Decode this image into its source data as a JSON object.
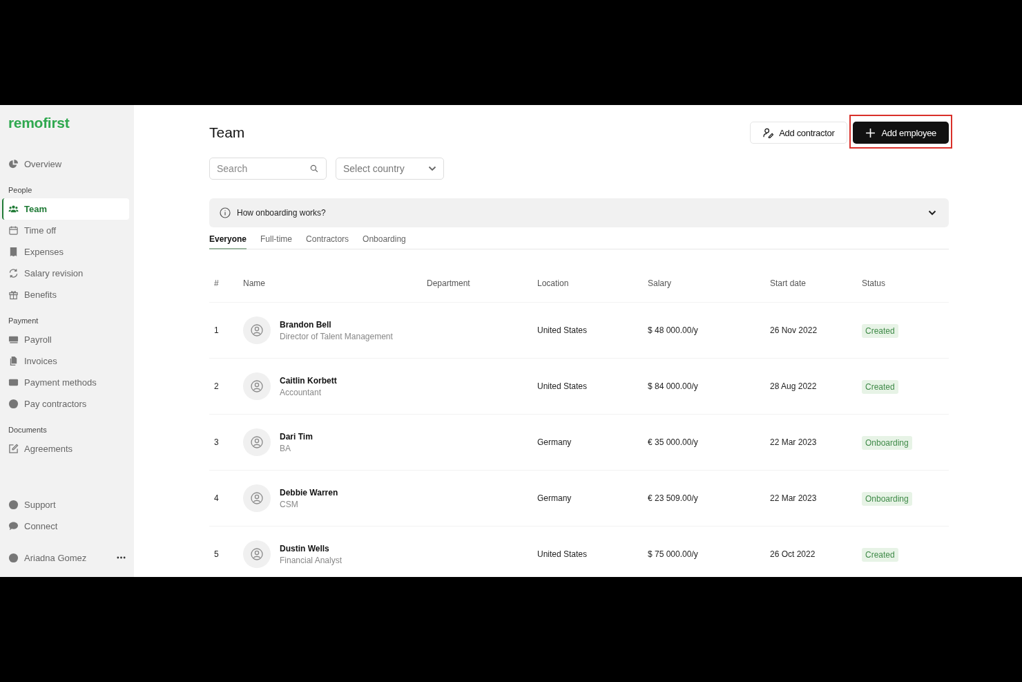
{
  "logo": "remofirst",
  "sidebar": {
    "sections": [
      {
        "items": [
          {
            "label": "Overview",
            "selected": false
          }
        ]
      },
      {
        "title": "People",
        "items": [
          {
            "label": "Team",
            "selected": true
          },
          {
            "label": "Time off",
            "selected": false
          },
          {
            "label": "Expenses",
            "selected": false
          },
          {
            "label": "Salary revision",
            "selected": false
          },
          {
            "label": "Benefits",
            "selected": false
          }
        ]
      },
      {
        "title": "Payment",
        "items": [
          {
            "label": "Payroll",
            "selected": false
          },
          {
            "label": "Invoices",
            "selected": false
          },
          {
            "label": "Payment methods",
            "selected": false
          },
          {
            "label": "Pay contractors",
            "selected": false
          }
        ]
      },
      {
        "title": "Documents",
        "items": [
          {
            "label": "Agreements",
            "selected": false
          }
        ]
      }
    ],
    "footer": [
      {
        "label": "Support",
        "selected": false
      },
      {
        "label": "Connect",
        "selected": false
      }
    ],
    "user": {
      "name": "Ariadna Gomez"
    }
  },
  "page": {
    "title": "Team",
    "buttons": [
      {
        "label": "Add contractor",
        "kind": "secondary"
      },
      {
        "label": "Add employee",
        "kind": "primary",
        "highlighted": true
      }
    ],
    "search": {
      "placeholder": "Search"
    },
    "country_select": {
      "placeholder": "Select country"
    },
    "info_banner": {
      "text": "How onboarding works?",
      "expanded": false
    },
    "tabs": [
      {
        "label": "Everyone",
        "selected": true
      },
      {
        "label": "Full-time",
        "selected": false
      },
      {
        "label": "Contractors",
        "selected": false
      },
      {
        "label": "Onboarding",
        "selected": false
      }
    ]
  },
  "table": {
    "columns": [
      "#",
      "Name",
      "Department",
      "Location",
      "Salary",
      "Start date",
      "Status"
    ],
    "rows": [
      {
        "index": "1",
        "name": "Brandon Bell",
        "role": "Director of Talent Management",
        "location": "United States",
        "salary": "$ 48 000.00/y",
        "start_date": "26 Nov 2022",
        "status": "Created"
      },
      {
        "index": "2",
        "name": "Caitlin Korbett",
        "role": "Accountant",
        "location": "United States",
        "salary": "$ 84 000.00/y",
        "start_date": "28 Aug 2022",
        "status": "Created"
      },
      {
        "index": "3",
        "name": "Dari Tim",
        "role": "BA",
        "location": "Germany",
        "salary": "€ 35 000.00/y",
        "start_date": "22 Mar 2023",
        "status": "Onboarding"
      },
      {
        "index": "4",
        "name": "Debbie Warren",
        "role": "CSM",
        "location": "Germany",
        "salary": "€ 23 509.00/y",
        "start_date": "22 Mar 2023",
        "status": "Onboarding"
      },
      {
        "index": "5",
        "name": "Dustin Wells",
        "role": "Financial Analyst",
        "location": "United States",
        "salary": "$ 75 000.00/y",
        "start_date": "26 Oct 2022",
        "status": "Created"
      }
    ]
  }
}
